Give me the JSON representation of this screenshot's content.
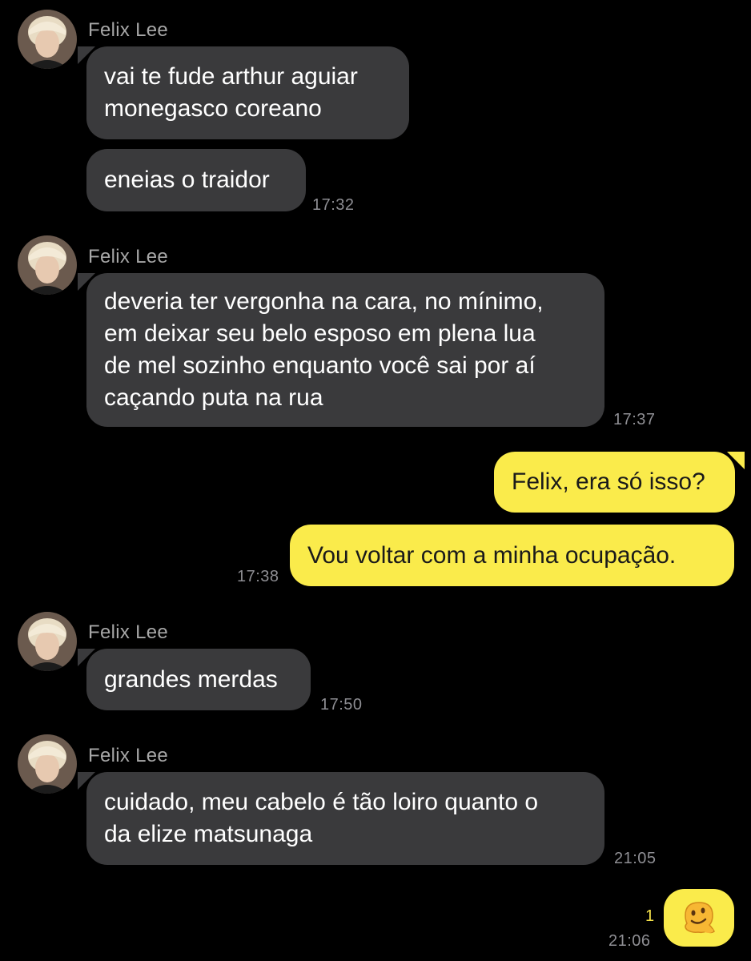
{
  "contact": {
    "name": "Felix Lee"
  },
  "groups": [
    {
      "sender": "Felix Lee",
      "messages": [
        {
          "text": "vai te fude arthur aguiar\nmonegasco coreano"
        },
        {
          "text": "eneias o traidor",
          "time": "17:32"
        }
      ]
    },
    {
      "sender": "Felix Lee",
      "messages": [
        {
          "text": "deveria ter vergonha na cara, no mínimo,\nem deixar seu belo esposo em plena lua\nde mel sozinho enquanto você sai por aí\ncaçando puta na rua",
          "time": "17:37"
        }
      ]
    },
    {
      "sender": "me",
      "messages": [
        {
          "text": "Felix, era só isso?"
        },
        {
          "text": "Vou voltar com a minha ocupação.",
          "time": "17:38"
        }
      ]
    },
    {
      "sender": "Felix Lee",
      "messages": [
        {
          "text": "grandes merdas",
          "time": "17:50"
        }
      ]
    },
    {
      "sender": "Felix Lee",
      "messages": [
        {
          "text": "cuidado, meu cabelo é tão loiro quanto o\nda elize matsunaga",
          "time": "21:05"
        }
      ]
    },
    {
      "sender": "me",
      "messages": [
        {
          "emoji": "melting-face-emoji",
          "unread_count": "1",
          "time": "21:06"
        }
      ]
    }
  ],
  "colors": {
    "background": "#000000",
    "incoming_bubble": "#3a3a3c",
    "outgoing_bubble": "#faeb4b",
    "timestamp": "#8e8e93",
    "sender_name": "#a7a7a7",
    "unread": "#f6e24a"
  }
}
